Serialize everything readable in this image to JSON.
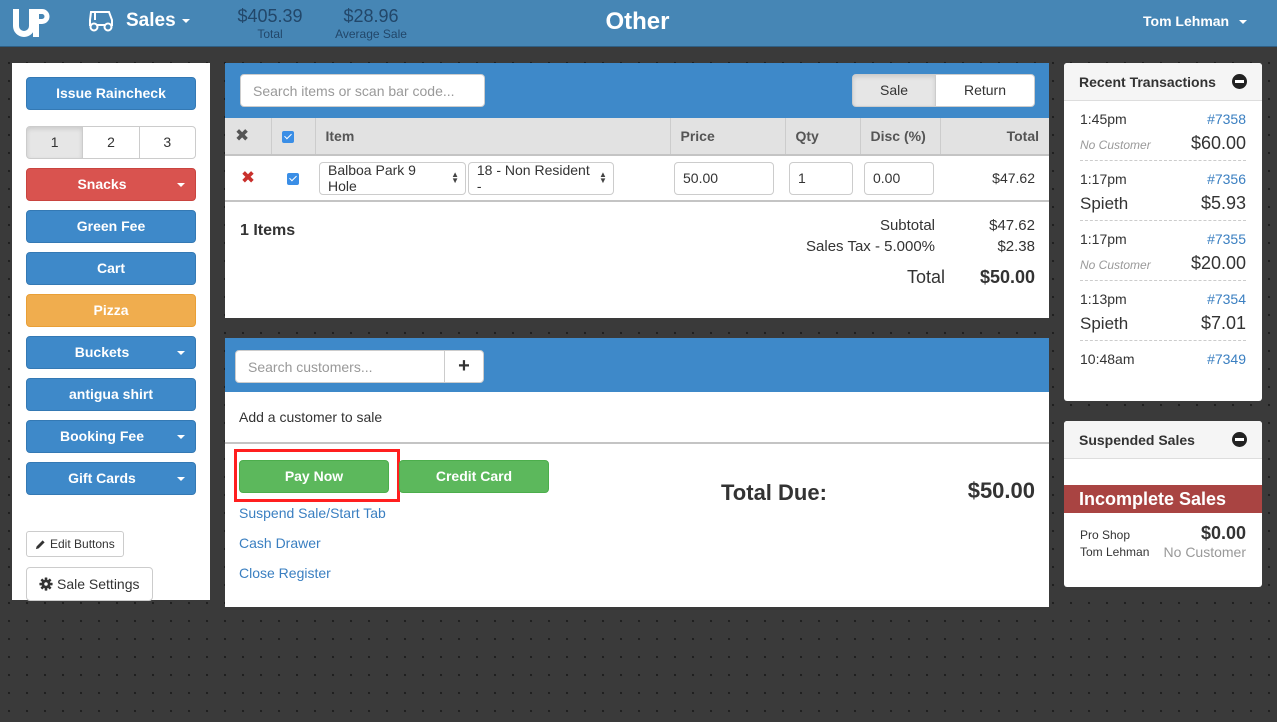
{
  "header": {
    "logo": "UP",
    "module_label": "Sales",
    "stats": [
      {
        "value": "$405.39",
        "label": "Total"
      },
      {
        "value": "$28.96",
        "label": "Average Sale"
      }
    ],
    "title": "Other",
    "user": "Tom Lehman",
    "colors": {
      "bar": "#4686b5"
    }
  },
  "quick_buttons": {
    "raincheck": "Issue Raincheck",
    "pages": [
      "1",
      "2",
      "3"
    ],
    "active_page": "1",
    "items": [
      {
        "label": "Snacks",
        "color": "red",
        "dropdown": true
      },
      {
        "label": "Green Fee",
        "color": "blue",
        "dropdown": false
      },
      {
        "label": "Cart",
        "color": "blue",
        "dropdown": false
      },
      {
        "label": "Pizza",
        "color": "orange",
        "dropdown": false
      },
      {
        "label": "Buckets",
        "color": "blue",
        "dropdown": true
      },
      {
        "label": "antigua shirt",
        "color": "blue",
        "dropdown": false
      },
      {
        "label": "Booking Fee",
        "color": "blue",
        "dropdown": true
      },
      {
        "label": "Gift Cards",
        "color": "blue",
        "dropdown": true
      }
    ],
    "edit_buttons": "Edit Buttons",
    "sale_settings": "Sale Settings"
  },
  "cart": {
    "search_placeholder": "Search items or scan bar code...",
    "mode": {
      "sale": "Sale",
      "return": "Return",
      "active": "Sale"
    },
    "columns": {
      "item": "Item",
      "price": "Price",
      "qty": "Qty",
      "disc": "Disc (%)",
      "total": "Total"
    },
    "rows": [
      {
        "item": "Balboa Park 9 Hole",
        "variant": "18 - Non Resident -",
        "price": "50.00",
        "qty": "1",
        "disc": "0.00",
        "total": "$47.62",
        "checked": true
      }
    ],
    "items_count": "1 Items",
    "subtotal_label": "Subtotal",
    "subtotal": "$47.62",
    "tax_label": "Sales Tax - 5.000%",
    "tax": "$2.38",
    "total_label": "Total",
    "total": "$50.00"
  },
  "customer": {
    "search_placeholder": "Search customers...",
    "add_label": "+",
    "info": "Add a customer to sale"
  },
  "payment": {
    "pay_now": "Pay Now",
    "credit_card": "Credit Card",
    "links": [
      "Suspend Sale/Start Tab",
      "Cash Drawer",
      "Close Register"
    ],
    "total_due_label": "Total Due:",
    "total_due": "$50.00"
  },
  "recent_transactions": {
    "title": "Recent Transactions",
    "items": [
      {
        "time": "1:45pm",
        "id": "#7358",
        "customer": "No Customer",
        "amount": "$60.00",
        "named": false
      },
      {
        "time": "1:17pm",
        "id": "#7356",
        "customer": "Spieth",
        "amount": "$5.93",
        "named": true
      },
      {
        "time": "1:17pm",
        "id": "#7355",
        "customer": "No Customer",
        "amount": "$20.00",
        "named": false
      },
      {
        "time": "1:13pm",
        "id": "#7354",
        "customer": "Spieth",
        "amount": "$7.01",
        "named": true
      },
      {
        "time": "10:48am",
        "id": "#7349"
      }
    ]
  },
  "suspended_sales": {
    "title": "Suspended Sales",
    "incomplete_title": "Incomplete Sales",
    "items": [
      {
        "location": "Pro Shop",
        "employee": "Tom Lehman",
        "amount": "$0.00",
        "customer": "No Customer"
      }
    ]
  }
}
